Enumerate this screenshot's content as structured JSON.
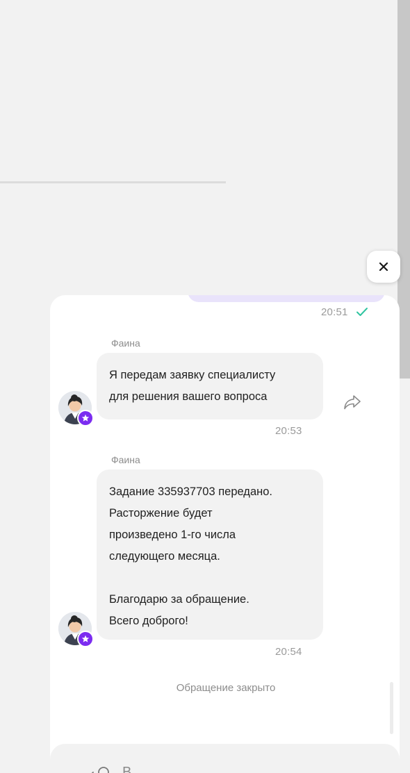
{
  "colors": {
    "page_bg": "#f2f2f2",
    "panel_bg": "#ffffff",
    "bubble_bg": "#f2f2f2",
    "own_bubble_bg": "#e9e3fb",
    "accent": "#7b2cf0",
    "check": "#2fc4a0",
    "muted_text": "#9a9a9a"
  },
  "close_button": {
    "icon": "close-icon"
  },
  "chat": {
    "outgoing_time": "20:51",
    "messages": [
      {
        "sender": "Фаина",
        "text": "Я передам заявку специалисту\nдля решения вашего вопроса",
        "time": "20:53",
        "forward_icon": "forward-icon"
      },
      {
        "sender": "Фаина",
        "text": "Задание 335937703 передано.\nРасторжение будет\nпроизведено 1-го числа\nследующего месяца.\n\nБлагодарю за обращение.\nВсего доброго!",
        "time": "20:54"
      }
    ],
    "status": "Обращение закрыто"
  },
  "input": {
    "placeholder": "В"
  }
}
